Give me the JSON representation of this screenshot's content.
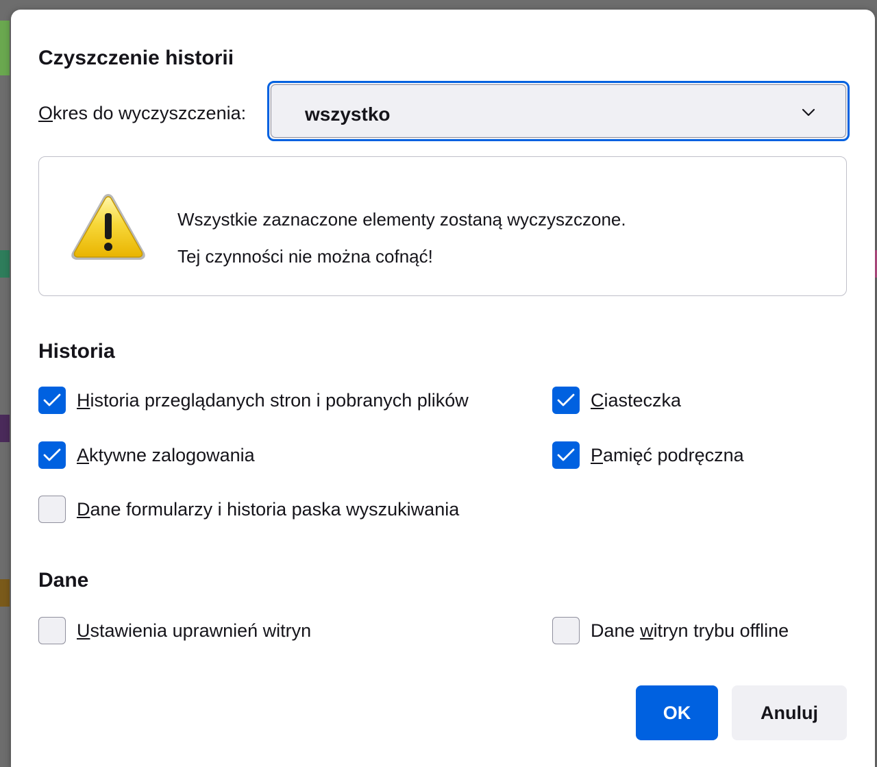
{
  "dialog": {
    "title": "Czyszczenie historii",
    "period": {
      "label_accesskey": "O",
      "label_rest": "kres do wyczyszczenia:",
      "selected": "wszystko"
    },
    "warning": {
      "line1": "Wszystkie zaznaczone elementy zostaną wyczyszczone.",
      "line2": "Tej czynności nie można cofnąć!"
    },
    "history_section": {
      "heading": "Historia",
      "items": [
        {
          "pre": "",
          "key": "H",
          "rest": "istoria przeglądanych stron i pobranych plików",
          "checked": true
        },
        {
          "pre": "",
          "key": "C",
          "rest": "iasteczka",
          "checked": true
        },
        {
          "pre": "",
          "key": "A",
          "rest": "ktywne zalogowania",
          "checked": true
        },
        {
          "pre": "",
          "key": "P",
          "rest": "amięć podręczna",
          "checked": true
        },
        {
          "pre": "",
          "key": "D",
          "rest": "ane formularzy i historia paska wyszukiwania",
          "checked": false
        }
      ]
    },
    "data_section": {
      "heading": "Dane",
      "items": [
        {
          "pre": "",
          "key": "U",
          "rest": "stawienia uprawnień witryn",
          "checked": false
        },
        {
          "pre": "Dane ",
          "key": "w",
          "rest": "itryn trybu offline",
          "checked": false
        }
      ]
    },
    "buttons": {
      "ok": "OK",
      "cancel": "Anuluj"
    }
  },
  "colors": {
    "accent": "#0061e0",
    "checkbox_unchecked_bg": "#f0f0f4",
    "text": "#15141a"
  }
}
